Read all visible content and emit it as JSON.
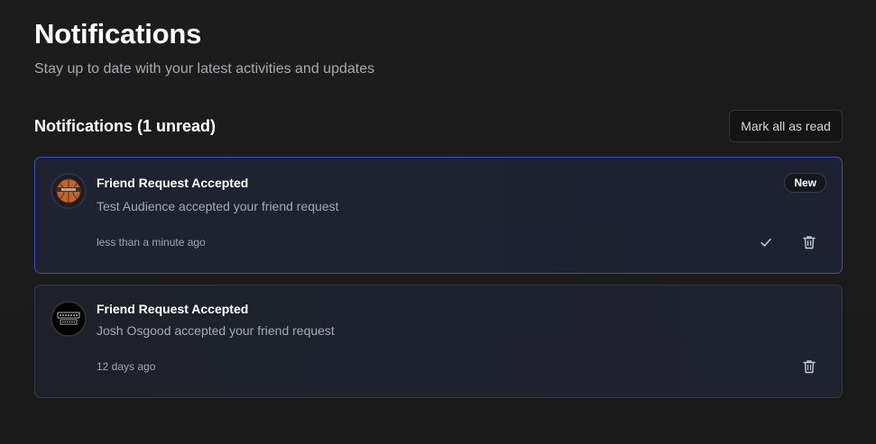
{
  "header": {
    "title": "Notifications",
    "subtitle": "Stay up to date with your latest activities and updates"
  },
  "section": {
    "title": "Notifications (1 unread)",
    "mark_all_label": "Mark all as read"
  },
  "notifications": [
    {
      "title": "Friend Request Accepted",
      "message": "Test Audience accepted your friend request",
      "time": "less than a minute ago",
      "badge": "New",
      "unread": true,
      "avatar": "basketball-avatar"
    },
    {
      "title": "Friend Request Accepted",
      "message": "Josh Osgood accepted your friend request",
      "time": "12 days ago",
      "unread": false,
      "avatar": "logo-avatar"
    }
  ],
  "colors": {
    "background": "#1a1a1a",
    "card": "#1f2330",
    "unread_border": "#3b4fb8",
    "muted_text": "#a7a9b0"
  }
}
